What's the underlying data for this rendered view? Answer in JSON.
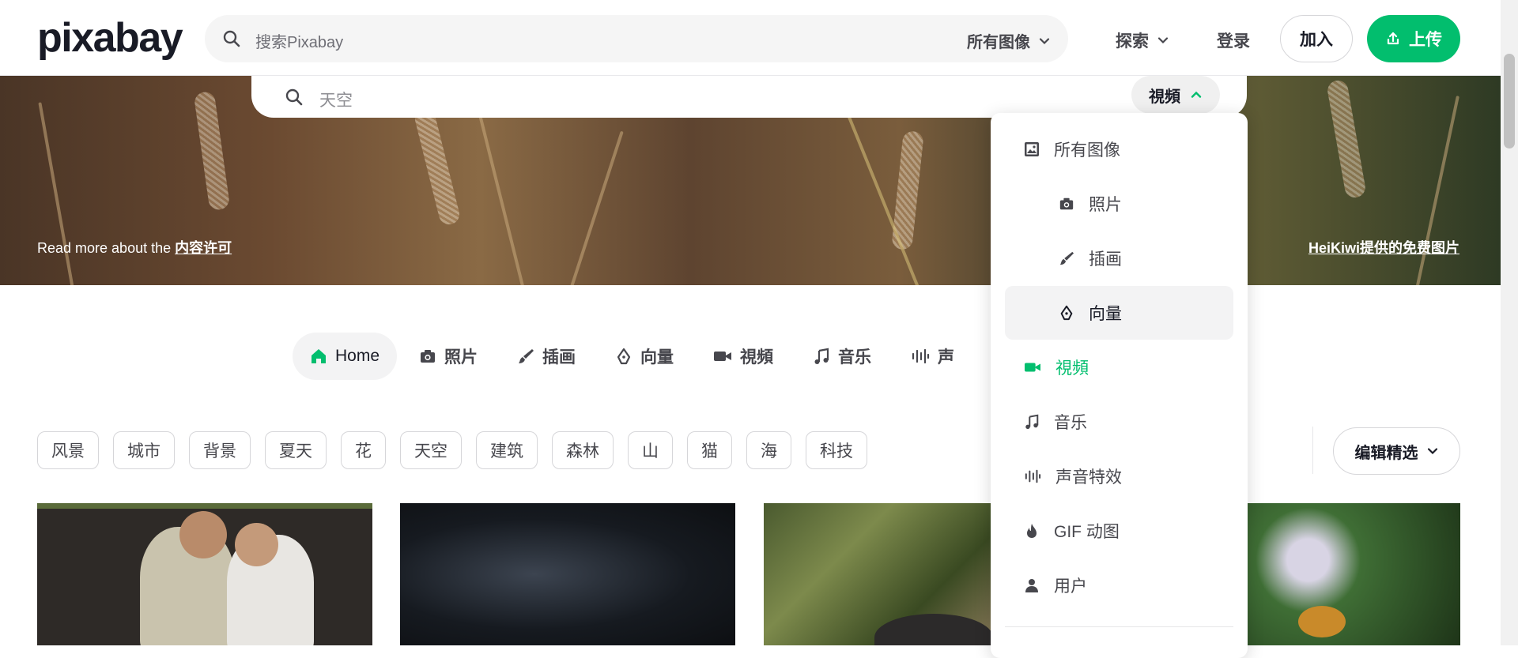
{
  "header": {
    "logo": "pixabay",
    "search_placeholder": "搜索Pixabay",
    "search_filter": "所有图像",
    "explore": "探索",
    "login": "登录",
    "join": "加入",
    "upload": "上传"
  },
  "hero": {
    "search_placeholder": "天空",
    "type_selected": "視頻",
    "note_prefix": "Read more about the ",
    "note_link": "内容许可",
    "credit": "HeiKiwi提供的免费图片"
  },
  "tabs": [
    {
      "label": "Home",
      "icon": "home-icon"
    },
    {
      "label": "照片",
      "icon": "camera-icon"
    },
    {
      "label": "插画",
      "icon": "brush-icon"
    },
    {
      "label": "向量",
      "icon": "pen-nib-icon"
    },
    {
      "label": "視頻",
      "icon": "video-icon"
    },
    {
      "label": "音乐",
      "icon": "music-icon"
    },
    {
      "label": "声",
      "icon": "waveform-icon"
    }
  ],
  "chips": [
    "风景",
    "城市",
    "背景",
    "夏天",
    "花",
    "天空",
    "建筑",
    "森林",
    "山",
    "猫",
    "海",
    "科技"
  ],
  "editor_pick": "编辑精选",
  "dropdown": {
    "items": [
      {
        "label": "所有图像",
        "icon": "image-icon"
      },
      {
        "label": "照片",
        "icon": "camera-icon"
      },
      {
        "label": "插画",
        "icon": "brush-icon"
      },
      {
        "label": "向量",
        "icon": "pen-nib-icon"
      },
      {
        "label": "視頻",
        "icon": "video-icon"
      },
      {
        "label": "音乐",
        "icon": "music-icon"
      },
      {
        "label": "声音特效",
        "icon": "waveform-icon"
      },
      {
        "label": "GIF 动图",
        "icon": "flame-icon"
      },
      {
        "label": "用户",
        "icon": "user-icon"
      }
    ]
  },
  "colors": {
    "accent": "#02be6e",
    "text": "#191b26",
    "muted": "#47474d"
  }
}
